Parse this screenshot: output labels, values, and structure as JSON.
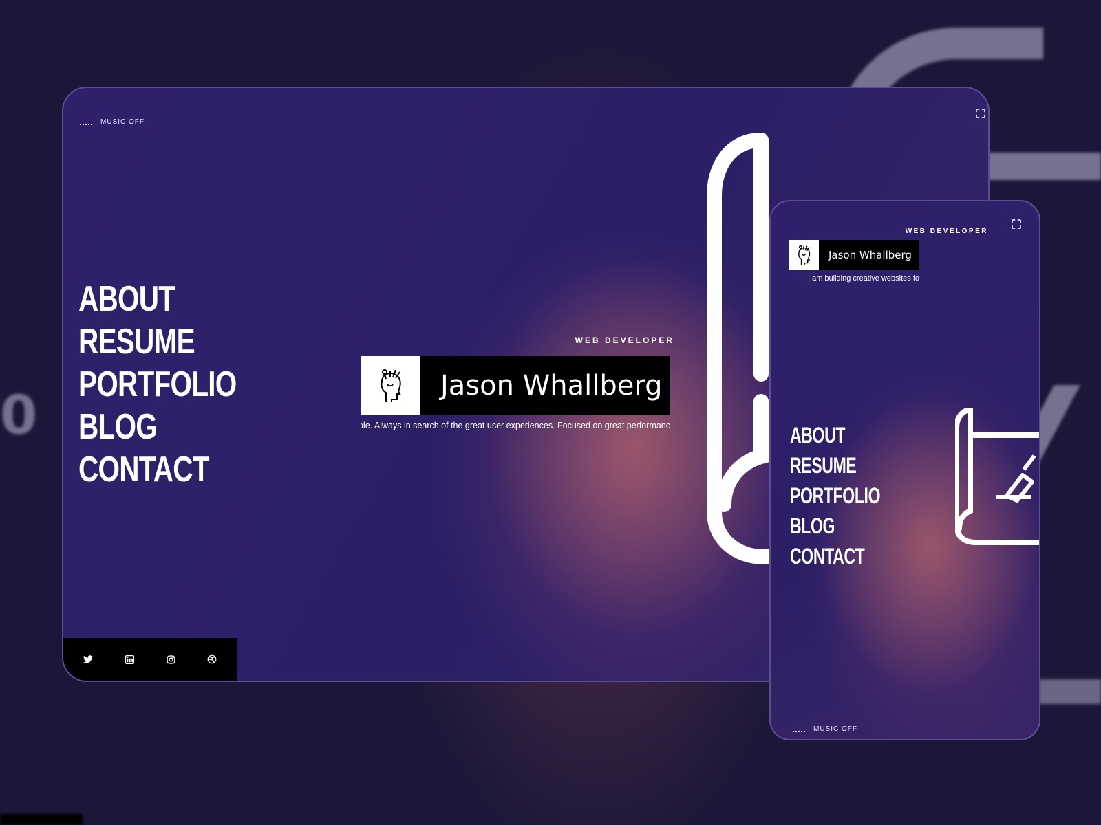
{
  "desktop": {
    "music_label": "MUSIC OFF",
    "nav": [
      "ABOUT",
      "RESUME",
      "PORTFOLIO",
      "BLOG",
      "CONTACT"
    ],
    "subtitle": "WEB DEVELOPER",
    "name": "Jason Whallberg",
    "intro": "ole. Always in search of the great user experiences. Focused on great performanc",
    "social_icons": [
      "twitter-icon",
      "linkedin-icon",
      "instagram-icon",
      "dribbble-icon"
    ]
  },
  "mobile": {
    "subtitle": "WEB DEVELOPER",
    "name": "Jason Whallberg",
    "intro": "I am building creative websites fo",
    "nav": [
      "ABOUT",
      "RESUME",
      "PORTFOLIO",
      "BLOG",
      "CONTACT"
    ],
    "music_label": "MUSIC OFF"
  },
  "colors": {
    "background": "#1c1739",
    "panel": "#2e2068",
    "accent_skin": "#d0766c",
    "border": "#5b4f93",
    "text": "#ffffff",
    "name_box": "#000000"
  }
}
